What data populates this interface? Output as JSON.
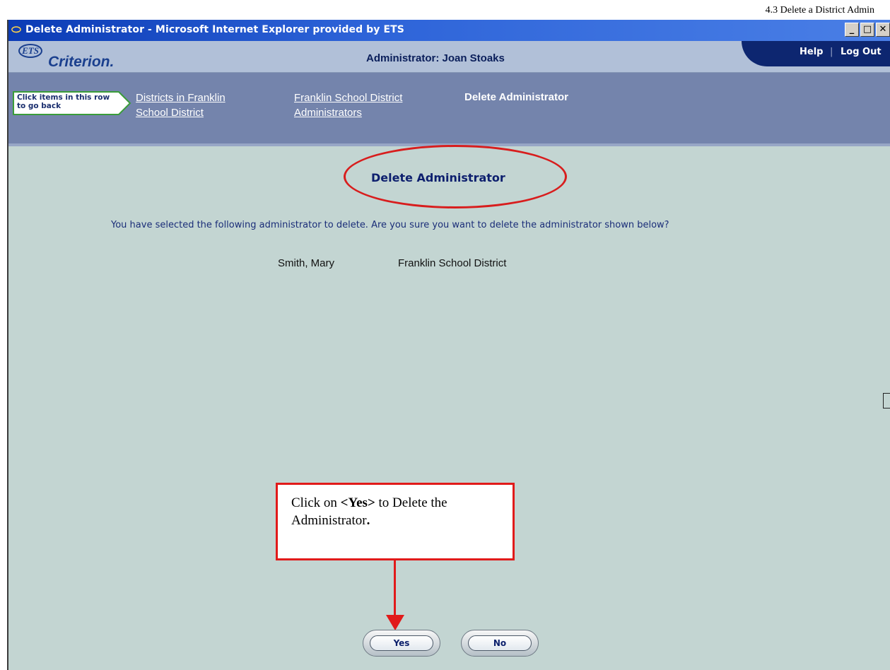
{
  "document": {
    "section_label": "4.3 Delete a District Admin"
  },
  "window": {
    "title": "Delete Administrator - Microsoft Internet Explorer provided by ETS",
    "controls": [
      "minimize-icon",
      "maximize-icon",
      "close-icon"
    ]
  },
  "app": {
    "logo_mark": "ETS",
    "logo_name": "Criterion.",
    "admin_title": "Administrator: Joan Stoaks",
    "help": "Help",
    "separator": "|",
    "logout": "Log Out"
  },
  "breadcrumb": {
    "back_hint": "Click items in this row to go back",
    "items": [
      {
        "label": "Districts in Franklin School District"
      },
      {
        "label": "Franklin School District Administrators"
      }
    ],
    "current": "Delete Administrator"
  },
  "main": {
    "heading": "Delete Administrator",
    "confirm_text": "You have selected the following administrator to delete. Are you sure you want to delete the administrator shown below?",
    "admin_name": "Smith, Mary",
    "admin_district": "Franklin School District",
    "yes_label": "Yes",
    "no_label": "No"
  },
  "annotation": {
    "callout_prefix": "Click on ",
    "callout_strong": "<Yes>",
    "callout_suffix": " to Delete the Administrator",
    "callout_end": "."
  },
  "colors": {
    "title_bar": "#0b3bb5",
    "content_bg": "#c3d5d2",
    "breadcrumb_bg": "#7484ac",
    "annotation_red": "#e11a1a"
  }
}
